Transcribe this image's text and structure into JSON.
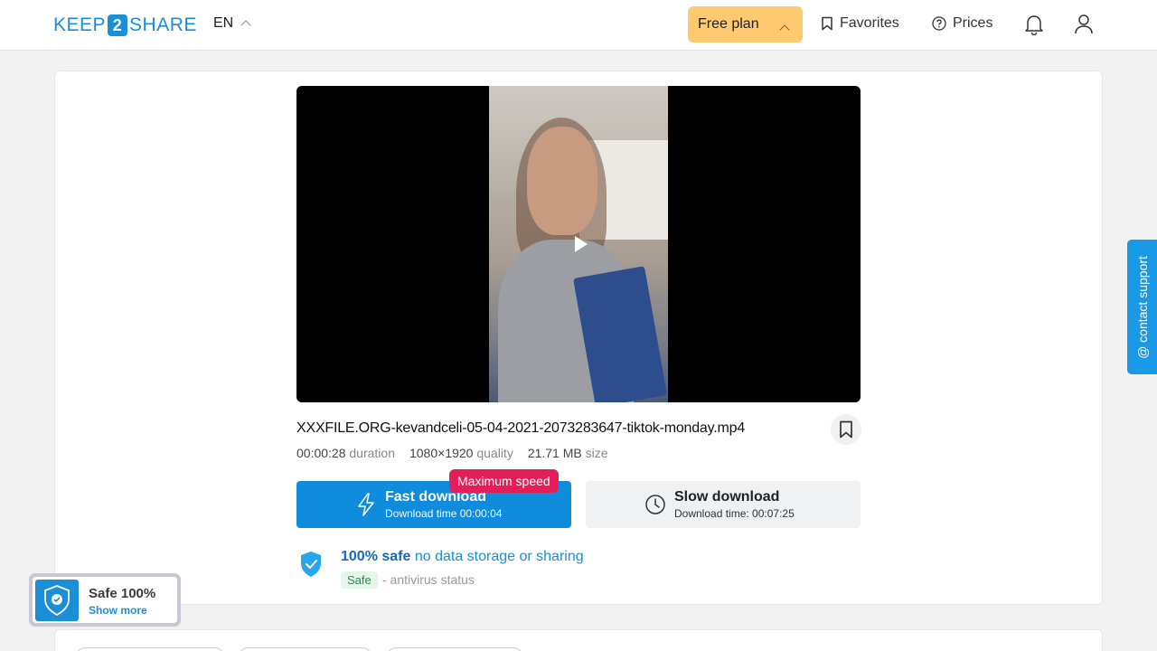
{
  "header": {
    "logo_left": "KEEP",
    "logo_num": "2",
    "logo_right": "SHARE",
    "language": "EN",
    "plan_label": "Free plan",
    "favorites_label": "Favorites",
    "prices_label": "Prices"
  },
  "file": {
    "name": "XXXFILE.ORG-kevandceli-05-04-2021-2073283647-tiktok-monday.mp4",
    "duration_value": "00:00:28",
    "duration_label": "duration",
    "quality_value": "1080×1920",
    "quality_label": "quality",
    "size_value": "21.71 MB",
    "size_label": "size"
  },
  "download": {
    "badge": "Maximum speed",
    "fast_title": "Fast download",
    "fast_sub": "Download time 00:00:04",
    "slow_title": "Slow download",
    "slow_sub": "Download time: 00:07:25"
  },
  "safety": {
    "bold": "100% safe",
    "text": " no data storage or sharing",
    "tag": "Safe",
    "status": "- antivirus status"
  },
  "support": {
    "label": "@ contact support"
  },
  "widget": {
    "title": "Safe 100%",
    "link": "Show more"
  },
  "colors": {
    "accent": "#0f8cdb",
    "plan": "#ffc970",
    "badge": "#e41d5b"
  }
}
